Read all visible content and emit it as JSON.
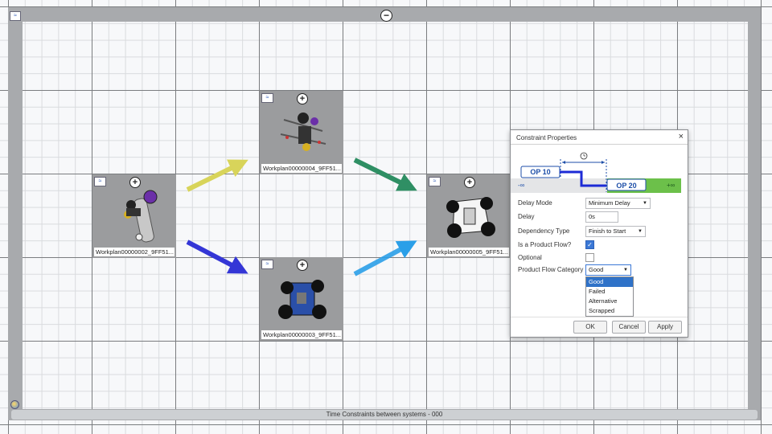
{
  "canvas": {
    "bottom_label": "Time Constraints between systems - 000",
    "collapse_symbol": "−"
  },
  "nodes": [
    {
      "id": "n2",
      "label": "Workplan00000002_9FF51...",
      "icon": "system-icon",
      "add": "+"
    },
    {
      "id": "n4",
      "label": "Workplan00000004_9FF51...",
      "icon": "system-icon",
      "add": "+"
    },
    {
      "id": "n3",
      "label": "Workplan00000003_9FF51...",
      "icon": "system-icon",
      "add": "+"
    },
    {
      "id": "n5",
      "label": "Workplan00000005_9FF51...",
      "icon": "system-icon",
      "add": "+"
    }
  ],
  "arrows": {
    "colors": {
      "yellow": "#d8d45a",
      "blue": "#3436d6",
      "green": "#2f8f64",
      "lightblue": "#2a9fe8"
    }
  },
  "dialog": {
    "title": "Constraint Properties",
    "close": "×",
    "diagram": {
      "op_from": "OP 10",
      "op_to": "OP 20",
      "neg_inf": "-∞",
      "pos_inf": "+∞",
      "clock_icon": "clock-icon"
    },
    "fields": {
      "delay_mode_label": "Delay Mode",
      "delay_mode_value": "Minimum Delay",
      "delay_label": "Delay",
      "delay_value": "0s",
      "dependency_type_label": "Dependency Type",
      "dependency_type_value": "Finish to Start",
      "is_product_flow_label": "Is a Product Flow?",
      "is_product_flow_checked": true,
      "optional_label": "Optional",
      "optional_checked": false,
      "product_flow_category_label": "Product Flow Category",
      "product_flow_category_value": "Good"
    },
    "dropdown_options": [
      "Good",
      "Failed",
      "Alternative",
      "Scrapped"
    ],
    "buttons": {
      "ok": "OK",
      "cancel": "Cancel",
      "apply": "Apply"
    },
    "colors": {
      "accent": "#1d4ea8",
      "green": "#6cc04a"
    }
  }
}
